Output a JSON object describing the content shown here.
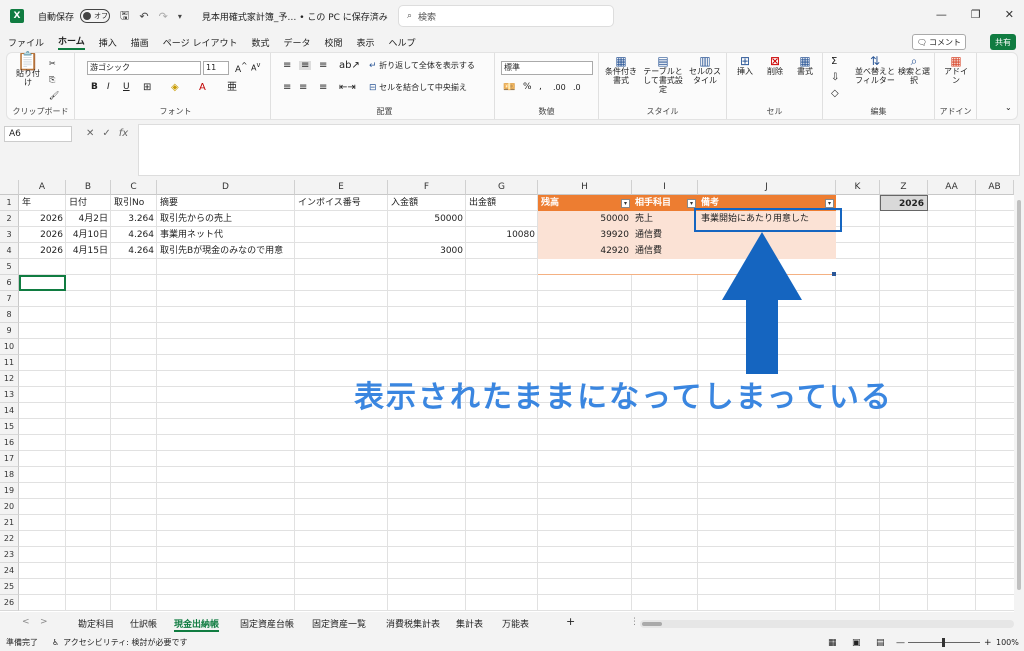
{
  "titlebar": {
    "autosave_label": "自動保存",
    "autosave_state": "オフ",
    "document_title": "見本用確式家計簿_予…  •  この PC に保存済み",
    "search_placeholder": "検索"
  },
  "ribbon_tabs": [
    "ファイル",
    "ホーム",
    "挿入",
    "描画",
    "ページ レイアウト",
    "数式",
    "データ",
    "校閲",
    "表示",
    "ヘルプ"
  ],
  "comment_label": "コメント",
  "share_label": "共有",
  "ribbon": {
    "clipboard": {
      "paste": "貼り付け",
      "label": "クリップボード"
    },
    "font": {
      "name": "游ゴシック",
      "size": "11",
      "label": "フォント"
    },
    "alignment": {
      "wrap": "折り返して全体を表示する",
      "merge": "セルを結合して中央揃え",
      "label": "配置"
    },
    "number": {
      "format": "標準",
      "label": "数値"
    },
    "styles": {
      "conditional": "条件付き書式",
      "table": "テーブルとして書式設定",
      "cellstyle": "セルのスタイル",
      "label": "スタイル"
    },
    "cells": {
      "insert": "挿入",
      "delete": "削除",
      "format": "書式",
      "label": "セル"
    },
    "editing": {
      "sort": "並べ替えとフィルター",
      "find": "検索と選択",
      "label": "編集"
    },
    "addins": {
      "label": "アドイン",
      "btn": "アドイン"
    }
  },
  "formula": {
    "name_box": "A6",
    "fx": "fx"
  },
  "columns": [
    "A",
    "B",
    "C",
    "D",
    "E",
    "F",
    "G",
    "H",
    "I",
    "J",
    "K",
    "Z",
    "AA",
    "AB"
  ],
  "rows": [
    "1",
    "2",
    "3",
    "4",
    "5",
    "6",
    "7",
    "8",
    "9",
    "10",
    "11",
    "12",
    "13",
    "14",
    "15",
    "16",
    "17",
    "18",
    "19",
    "20",
    "21",
    "22",
    "23",
    "24",
    "25",
    "26"
  ],
  "headers": {
    "a": "年",
    "b": "日付",
    "c": "取引No",
    "d": "摘要",
    "e": "インボイス番号",
    "f": "入金額",
    "g": "出金額",
    "h": "残高",
    "i": "相手科目",
    "j": "備考"
  },
  "z1": "2026",
  "data_rows": [
    {
      "year": "2026",
      "date": "4月2日",
      "no": "3.264",
      "memo": "取引先からの売上",
      "in": "50000",
      "out": "",
      "bal": "50000",
      "acct": "売上",
      "note": "事業開始にあたり用意した"
    },
    {
      "year": "2026",
      "date": "4月10日",
      "no": "4.264",
      "memo": "事業用ネット代",
      "in": "",
      "out": "10080",
      "bal": "39920",
      "acct": "通信費",
      "note": ""
    },
    {
      "year": "2026",
      "date": "4月15日",
      "no": "4.264",
      "memo": "取引先Bが現金のみなので用意",
      "in": "3000",
      "out": "",
      "bal": "42920",
      "acct": "通信費",
      "note": ""
    }
  ],
  "annotation": "表示されたままになってしまっている",
  "sheets": [
    "勘定科目",
    "仕訳帳",
    "現金出納帳",
    "固定資産台帳",
    "固定資産一覧",
    "消費税集計表",
    "集計表",
    "万能表"
  ],
  "active_sheet": "現金出納帳",
  "status": {
    "ready": "準備完了",
    "accessibility": "アクセシビリティ: 検討が必要です",
    "zoom": "100%"
  },
  "colors": {
    "excel_green": "#107c41",
    "table_header": "#ed7d31",
    "table_band": "#fbe2d5",
    "annotation": "#1565c0"
  }
}
